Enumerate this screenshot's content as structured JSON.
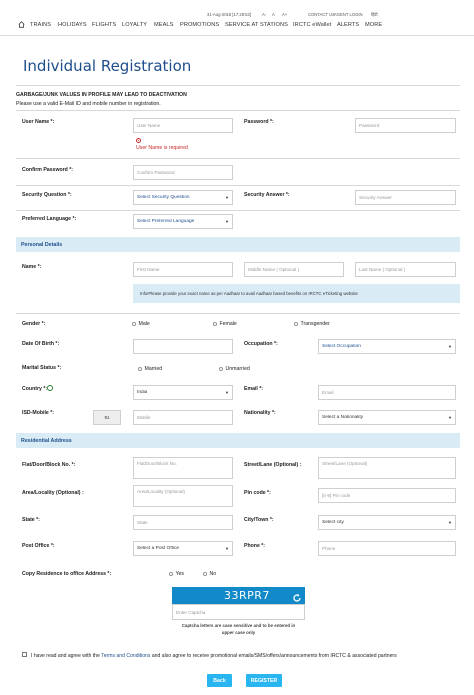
{
  "topbar": {
    "datetime": "31-Aug-2018 [17:28:53]",
    "font_small": "A-",
    "font_normal": "A",
    "font_large": "A+",
    "contact": "CONTACT US",
    "agent_login": "AGENT LOGIN",
    "language": "हिंदी"
  },
  "nav": {
    "items": [
      "TRAINS",
      "HOLIDAYS",
      "FLIGHTS",
      "LOYALTY",
      "MEALS",
      "PROMOTIONS",
      "SERVICE AT STATIONS",
      "IRCTC eWallet",
      "ALERTS",
      "MORE"
    ]
  },
  "page": {
    "title": "Individual Registration",
    "warning": "GARBAGE/JUNK VALUES IN PROFILE MAY LEAD TO DEACTIVATION",
    "note": "Please use a valid E-Mail ID and mobile number in registration."
  },
  "form": {
    "username_label": "User Name *:",
    "username_placeholder": "User Name",
    "username_error": "User Name is required",
    "password_label": "Password *:",
    "password_placeholder": "Password",
    "confirm_label": "Confirm Password *:",
    "confirm_placeholder": "Confirm Password",
    "sec_question_label": "Security Question *:",
    "sec_question_value": "Select Security Question",
    "sec_answer_label": "Security Answer *:",
    "sec_answer_placeholder": "Security Answer",
    "pref_lang_label": "Preferred Language *:",
    "pref_lang_value": "Select Preferred Language"
  },
  "personal": {
    "section_title": "Personal Details",
    "name_label": "Name *:",
    "first_name": "First Name",
    "middle_name": "Middle Name ( Optional )",
    "last_name": "Last Name ( Optional )",
    "info": "Info!Please provide your exact name as per Aadhaar to avail Aadhaar based benefits on IRCTC eTicketing website",
    "gender_label": "Gender *:",
    "gender_options": [
      "Male",
      "Female",
      "Transgender"
    ],
    "dob_label": "Date Of Birth *:",
    "occupation_label": "Occupation *:",
    "occupation_value": "Select Occupation",
    "marital_label": "Marital Status *:",
    "marital_options": [
      "Married",
      "Unmarried"
    ],
    "country_label": "Country *:",
    "country_value": "India",
    "email_label": "Email *:",
    "email_placeholder": "Email",
    "isd_label": "ISD-Mobile *:",
    "isd_value": "91",
    "mobile_placeholder": "Mobile",
    "nationality_label": "Nationality *:",
    "nationality_value": "Select a Nationality"
  },
  "address": {
    "section_title": "Residential Address",
    "flat_label": "Flat/Door/Block No. *:",
    "flat_placeholder": "Flat/Door/Block No.",
    "street_label": "Street/Lane (Optional) :",
    "street_placeholder": "Street/Lane (Optional)",
    "area_label": "Area/Locality (Optional) :",
    "area_placeholder": "Area/Locality (Optional)",
    "pin_label": "Pin code *:",
    "pin_placeholder": "[0-9] Pin code",
    "state_label": "State *:",
    "state_placeholder": "State",
    "city_label": "City/Town *:",
    "city_value": "Select city",
    "post_label": "Post Office *:",
    "post_value": "Select a Post Office",
    "phone_label": "Phone *:",
    "phone_placeholder": "Phone",
    "copy_label": "Copy Residence to office Address *:",
    "copy_options": [
      "Yes",
      "No"
    ]
  },
  "captcha": {
    "text": "33RPR7",
    "input_placeholder": "Enter Captcha",
    "note1": "Captcha letters are case sensitive and to be entered in",
    "note2": "upper case only"
  },
  "agreement": {
    "prefix": "I have read and agree with the",
    "link": "Terms and Conditions",
    "suffix": "and also agree to receive promotional emails/SMS/offers/announcements from IRCTC & associated partners"
  },
  "buttons": {
    "back": "Back",
    "register": "REGISTER"
  },
  "colors": {
    "accent": "#1f4e8c",
    "section_bg": "#d9ebf5",
    "error": "#c62828",
    "button": "#29b6f0",
    "captcha_bg": "#1289c9"
  }
}
